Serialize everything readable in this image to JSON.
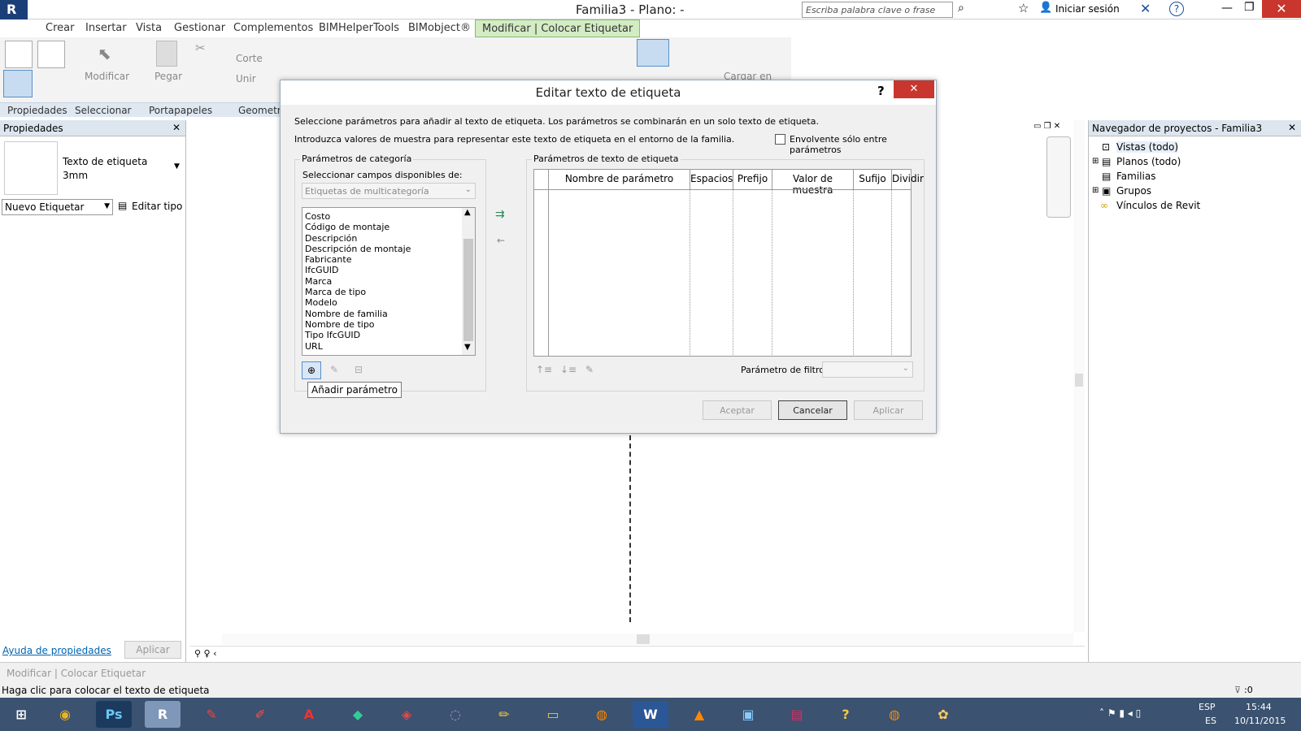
{
  "app": {
    "title": "Familia3 - Plano: -",
    "search_placeholder": "Escriba palabra clave o frase",
    "signin": "Iniciar sesión"
  },
  "ribbon_tabs": [
    "Crear",
    "Insertar",
    "Vista",
    "Gestionar",
    "Complementos",
    "BIMHelperTools",
    "BIMobject®",
    "Modificar | Colocar Etiquetar"
  ],
  "ribbon": {
    "modify_label": "Modificar",
    "paste_label": "Pegar",
    "cut_label": "Corte",
    "join_label": "Unir",
    "load_label": "Cargar en",
    "panels": [
      "Propiedades",
      "Seleccionar",
      "Portapapeles",
      "Geometrí"
    ]
  },
  "properties": {
    "header": "Propiedades",
    "type_name": "Texto de etiqueta",
    "type_size": "3mm",
    "selector": "Nuevo Etiquetar",
    "edit_type": "Editar tipo",
    "help_link": "Ayuda de propiedades",
    "apply": "Aplicar"
  },
  "project_browser": {
    "header": "Navegador de proyectos - Familia3",
    "items": [
      "Vistas (todo)",
      "Planos (todo)",
      "Familias",
      "Grupos",
      "Vínculos de Revit"
    ]
  },
  "dialog": {
    "title": "Editar texto de etiqueta",
    "help": "?",
    "intro1": "Seleccione parámetros para añadir al texto de etiqueta. Los parámetros se combinarán en un solo texto de etiqueta.",
    "intro2": "Introduzca valores de muestra para representar este texto de etiqueta en el entorno de la familia.",
    "wrap_label": "Envolvente sólo entre parámetros",
    "category_group": "Parámetros de categoría",
    "select_from": "Seleccionar campos disponibles de:",
    "category_value": "Etiquetas de multicategoría",
    "params": [
      "Costo",
      "Código de montaje",
      "Descripción",
      "Descripción de montaje",
      "Fabricante",
      "IfcGUID",
      "Marca",
      "Marca de tipo",
      "Modelo",
      "Nombre de familia",
      "Nombre de tipo",
      "Tipo IfcGUID",
      "URL"
    ],
    "label_group": "Parámetros de texto de etiqueta",
    "columns": [
      "Nombre de parámetro",
      "Espacios",
      "Prefijo",
      "Valor de muestra",
      "Sufijo",
      "Dividir"
    ],
    "filter_label": "Parámetro de filtro:",
    "tooltip": "Añadir parámetro",
    "ok": "Aceptar",
    "cancel": "Cancelar",
    "apply": "Aplicar"
  },
  "status": {
    "mode": "Modificar | Colocar Etiquetar",
    "hint": "Haga clic para colocar el texto de etiqueta",
    "filter_count": ":0"
  },
  "taskbar": {
    "lang": "ESP",
    "lang2": "ES",
    "time": "15:44",
    "date": "10/11/2015"
  }
}
